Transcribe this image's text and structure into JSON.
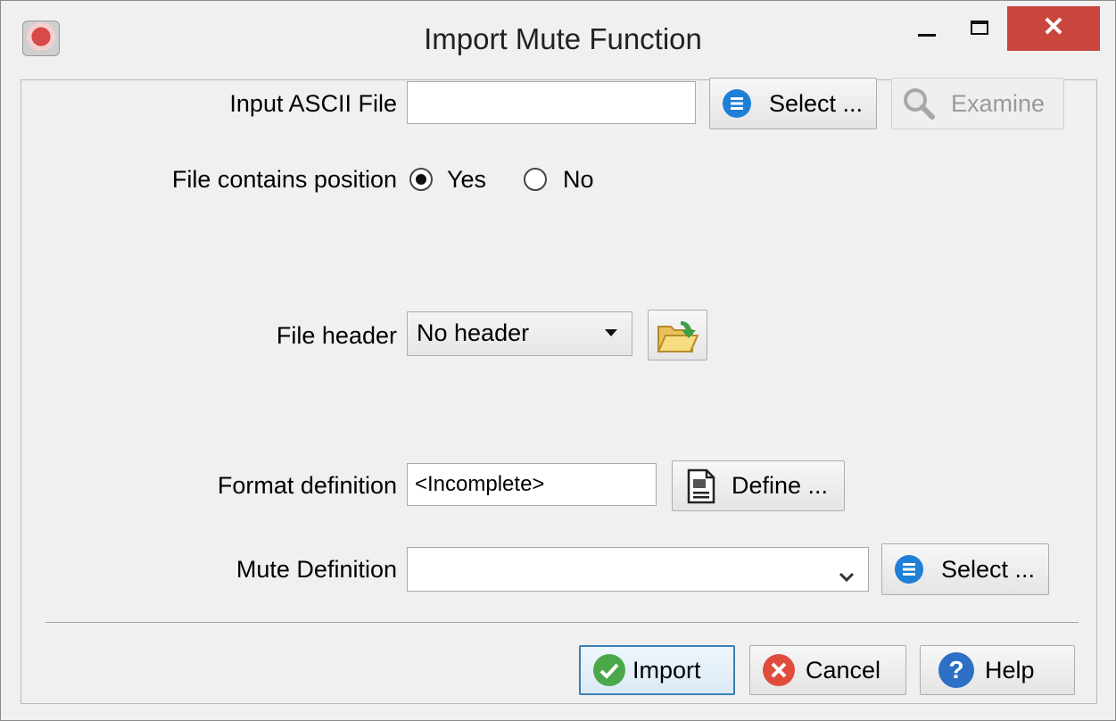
{
  "window": {
    "title": "Import Mute Function",
    "close_glyph": "✕"
  },
  "form": {
    "input_ascii_file": {
      "label": "Input ASCII File",
      "value": "",
      "select_label": "Select ...",
      "examine_label": "Examine"
    },
    "file_contains_position": {
      "label": "File contains position",
      "options": [
        "Yes",
        "No"
      ],
      "selected": "Yes"
    },
    "file_header": {
      "label": "File header",
      "value": "No header"
    },
    "format_definition": {
      "label": "Format definition",
      "value": "<Incomplete>",
      "define_label": "Define ..."
    },
    "mute_definition": {
      "label": "Mute Definition",
      "value": "",
      "select_label": "Select ..."
    }
  },
  "buttons": {
    "import_label": "Import",
    "cancel_label": "Cancel",
    "help_label": "Help"
  },
  "icons": {
    "select": "list-icon",
    "examine": "magnifier-icon",
    "open_folder": "folder-open-icon",
    "define": "document-code-icon",
    "import": "check-icon",
    "cancel": "cancel-x-icon",
    "help": "question-icon"
  },
  "colors": {
    "close_button": "#c9463d",
    "select_icon_blue": "#1e7fd6",
    "import_icon_green": "#4aa84a",
    "cancel_icon_red": "#e04c3c",
    "help_icon_blue": "#2d6fc4"
  }
}
